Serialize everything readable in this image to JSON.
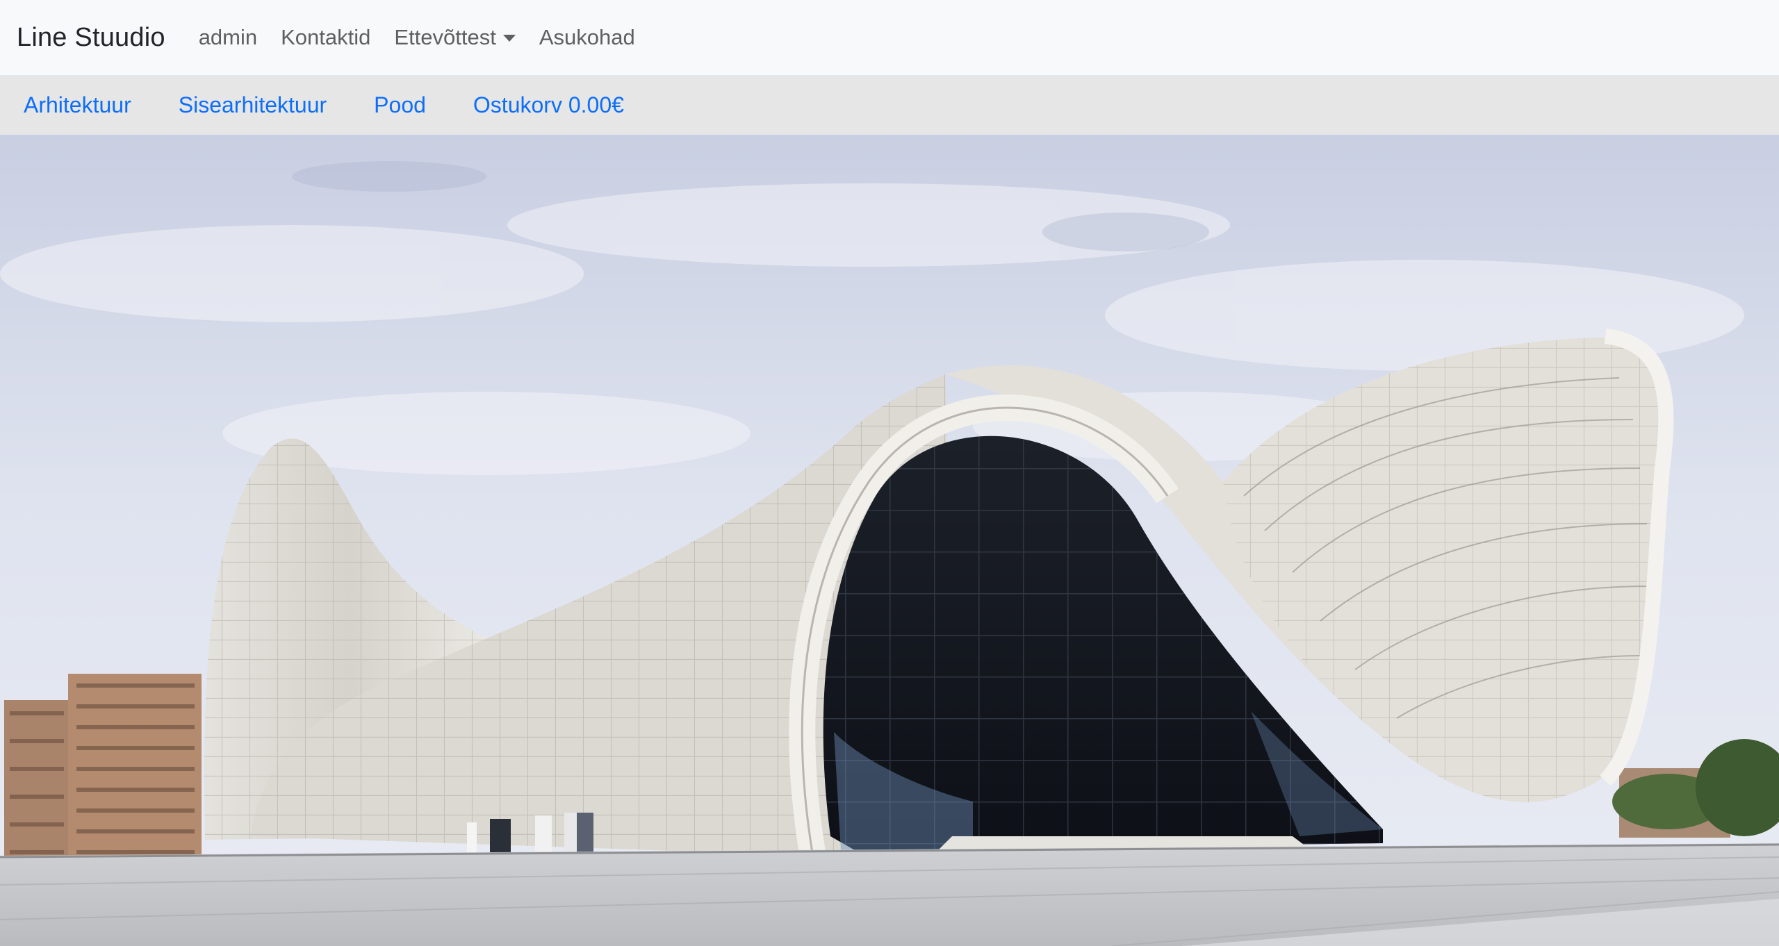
{
  "navbar": {
    "brand": "Line Stuudio",
    "links": [
      {
        "label": "admin"
      },
      {
        "label": "Kontaktid"
      },
      {
        "label": "Ettevõttest",
        "dropdown": true
      },
      {
        "label": "Asukohad"
      }
    ]
  },
  "subnav": {
    "links": [
      {
        "label": "Arhitektuur"
      },
      {
        "label": "Sisearhitektuur"
      },
      {
        "label": "Pood"
      },
      {
        "label": "Ostukorv 0.00€"
      }
    ]
  },
  "colors": {
    "link_blue": "#0d6efd",
    "navbar_bg": "#f8f9fa",
    "subnav_bg": "#e6e6e6"
  }
}
